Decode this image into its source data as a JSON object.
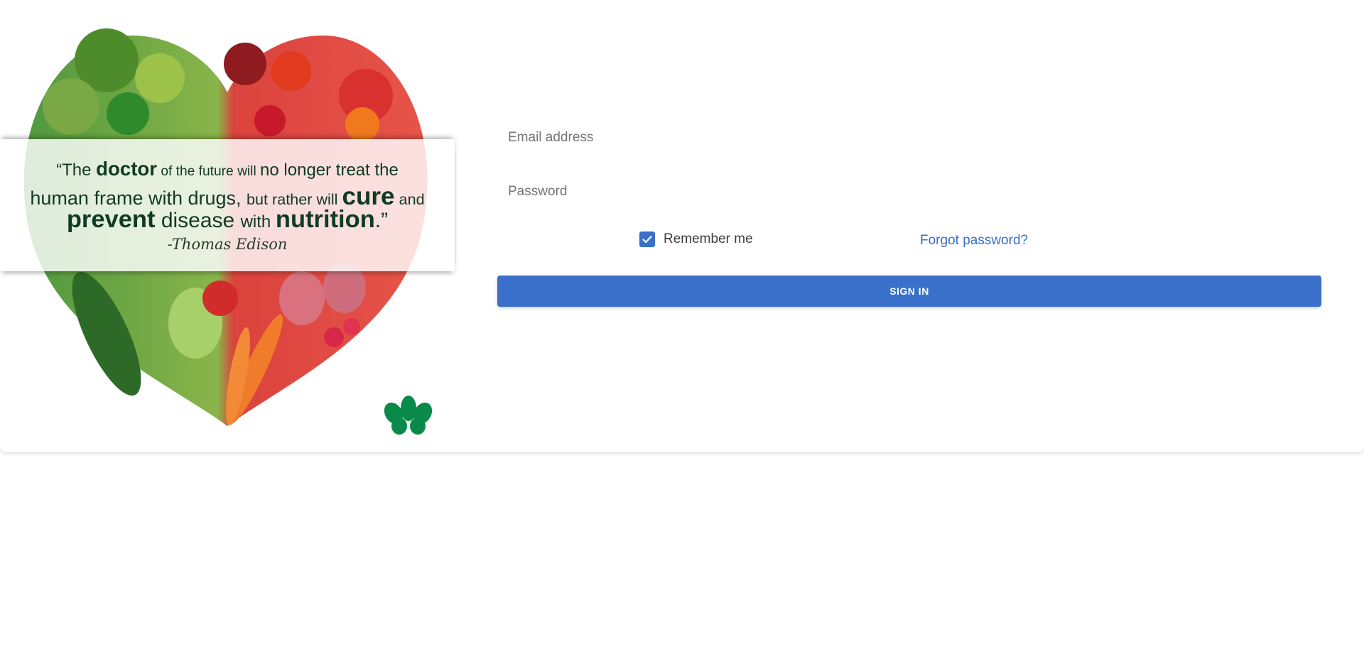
{
  "hero": {
    "quote": {
      "line1": {
        "a": "“The ",
        "b": "doctor",
        "c": " of the future will ",
        "d": "no longer treat the"
      },
      "line2": {
        "a": "human frame with drugs, ",
        "b": "but rather will ",
        "c": "cure",
        "d": " and"
      },
      "line3": {
        "a": "prevent",
        "b": " disease ",
        "c": "with ",
        "d": "nutrition",
        "e": ".”"
      },
      "author": "-Thomas Edison"
    },
    "logo_icon": "leaf-logo-icon"
  },
  "form": {
    "email_placeholder": "Email address",
    "password_placeholder": "Password",
    "remember_me_label": "Remember me",
    "remember_me_checked": true,
    "forgot_password_label": "Forgot password?",
    "sign_in_label": "SIGN IN"
  },
  "colors": {
    "primary": "#3a70c9",
    "logo_green": "#0a8a4a",
    "quote_text": "#0f3a24"
  }
}
